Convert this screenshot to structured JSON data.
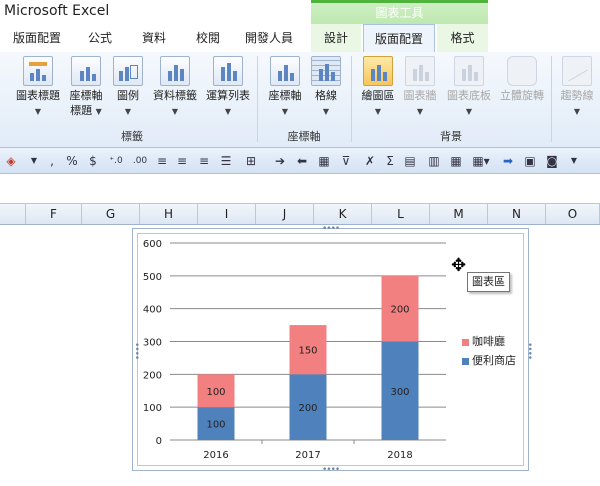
{
  "app": {
    "title": "Microsoft Excel",
    "context_group": "圖表工具"
  },
  "tabs": [
    {
      "label": "版面配置"
    },
    {
      "label": "公式"
    },
    {
      "label": "資料"
    },
    {
      "label": "校閱"
    },
    {
      "label": "開發人員"
    },
    {
      "label": "設計"
    },
    {
      "label": "版面配置"
    },
    {
      "label": "格式"
    }
  ],
  "ribbon": {
    "groups": {
      "labels": "標籤",
      "axes": "座標軸",
      "background": "背景"
    },
    "buttons": {
      "chart_title": "圖表標題",
      "axis_titles_1": "座標軸",
      "axis_titles_2": "標題",
      "legend": "圖例",
      "data_labels": "資料標籤",
      "data_table": "運算列表",
      "axes": "座標軸",
      "gridlines": "格線",
      "plot_area": "繪圖區",
      "chart_wall": "圖表牆",
      "chart_floor": "圖表底板",
      "rotation_3d": "立體旋轉",
      "trendline": "趨勢線"
    }
  },
  "columns": [
    "F",
    "G",
    "H",
    "I",
    "J",
    "K",
    "L",
    "M",
    "N",
    "O"
  ],
  "chart_data": {
    "type": "bar",
    "stacked": true,
    "categories": [
      "2016",
      "2017",
      "2018"
    ],
    "series": [
      {
        "name": "便利商店",
        "values": [
          100,
          200,
          300
        ],
        "color": "#4f81bd"
      },
      {
        "name": "咖啡廳",
        "values": [
          100,
          150,
          200
        ],
        "color": "#f28080"
      }
    ],
    "ylim": [
      0,
      600
    ],
    "yticks": [
      0,
      100,
      200,
      300,
      400,
      500,
      600
    ],
    "grid": true,
    "legend": "right"
  },
  "tooltip": "圖表區"
}
